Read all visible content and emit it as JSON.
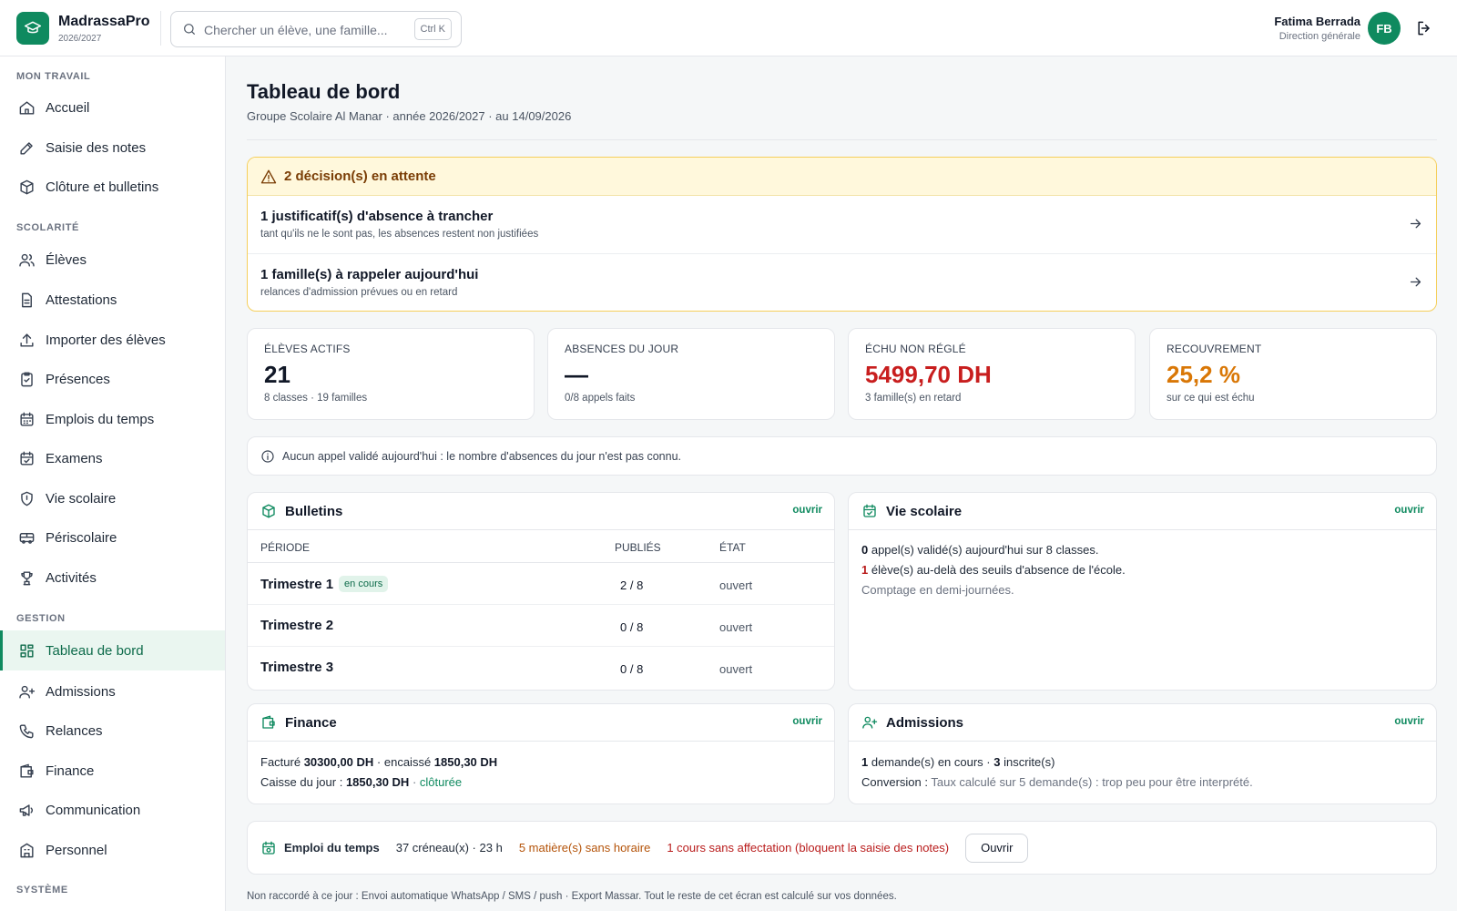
{
  "brand": {
    "name": "MadrassaPro",
    "year": "2026/2027"
  },
  "search": {
    "placeholder": "Chercher un élève, une famille...",
    "shortcut": "Ctrl K"
  },
  "user": {
    "name": "Fatima Berrada",
    "role": "Direction générale",
    "initials": "FB"
  },
  "sidebar": {
    "sections": [
      {
        "label": "MON TRAVAIL",
        "items": [
          {
            "label": "Accueil",
            "icon": "home-icon"
          },
          {
            "label": "Saisie des notes",
            "icon": "pencil-icon"
          },
          {
            "label": "Clôture et bulletins",
            "icon": "package-icon"
          }
        ]
      },
      {
        "label": "SCOLARITÉ",
        "items": [
          {
            "label": "Élèves",
            "icon": "users-icon"
          },
          {
            "label": "Attestations",
            "icon": "document-icon"
          },
          {
            "label": "Importer des élèves",
            "icon": "upload-icon"
          },
          {
            "label": "Présences",
            "icon": "clipboard-check-icon"
          },
          {
            "label": "Emplois du temps",
            "icon": "calendar-icon"
          },
          {
            "label": "Examens",
            "icon": "calendar-check-icon"
          },
          {
            "label": "Vie scolaire",
            "icon": "shield-icon"
          },
          {
            "label": "Périscolaire",
            "icon": "bus-icon"
          },
          {
            "label": "Activités",
            "icon": "trophy-icon"
          }
        ]
      },
      {
        "label": "GESTION",
        "items": [
          {
            "label": "Tableau de bord",
            "icon": "dashboard-icon",
            "active": true
          },
          {
            "label": "Admissions",
            "icon": "user-plus-icon"
          },
          {
            "label": "Relances",
            "icon": "phone-icon"
          },
          {
            "label": "Finance",
            "icon": "wallet-icon"
          },
          {
            "label": "Communication",
            "icon": "megaphone-icon"
          },
          {
            "label": "Personnel",
            "icon": "building-icon"
          }
        ]
      },
      {
        "label": "SYSTÈME",
        "items": []
      }
    ]
  },
  "page": {
    "title": "Tableau de bord",
    "subtitle": "Groupe Scolaire Al Manar · année 2026/2027 · au 14/09/2026"
  },
  "alert": {
    "title": "2 décision(s) en attente",
    "items": [
      {
        "title": "1 justificatif(s) d'absence à trancher",
        "sub": "tant qu'ils ne le sont pas, les absences restent non justifiées"
      },
      {
        "title": "1 famille(s) à rappeler aujourd'hui",
        "sub": "relances d'admission prévues ou en retard"
      }
    ]
  },
  "kpis": [
    {
      "label": "ÉLÈVES ACTIFS",
      "value": "21",
      "sub": "8 classes · 19 familles",
      "color": "#111827"
    },
    {
      "label": "ABSENCES DU JOUR",
      "value": "—",
      "sub": "0/8 appels faits",
      "color": "#111827"
    },
    {
      "label": "ÉCHU NON RÉGLÉ",
      "value": "5499,70 DH",
      "sub": "3 famille(s) en retard",
      "color": "#c81e1e"
    },
    {
      "label": "RECOUVREMENT",
      "value": "25,2 %",
      "sub": "sur ce qui est échu",
      "color": "#d97706"
    }
  ],
  "info": "Aucun appel validé aujourd'hui : le nombre d'absences du jour n'est pas connu.",
  "bulletins": {
    "title": "Bulletins",
    "open": "ouvrir",
    "columns": [
      "PÉRIODE",
      "PUBLIÉS",
      "ÉTAT"
    ],
    "rows": [
      {
        "period": "Trimestre 1",
        "badge": "en cours",
        "published": "2 / 8",
        "state": "ouvert"
      },
      {
        "period": "Trimestre 2",
        "badge": "",
        "published": "0 / 8",
        "state": "ouvert"
      },
      {
        "period": "Trimestre 3",
        "badge": "",
        "published": "0 / 8",
        "state": "ouvert"
      }
    ]
  },
  "vie_scolaire": {
    "title": "Vie scolaire",
    "open": "ouvrir",
    "line1_num": "0",
    "line1_text": " appel(s) validé(s) aujourd'hui sur 8 classes.",
    "line2_num": "1",
    "line2_text": " élève(s) au-delà des seuils d'absence de l'école.",
    "line3": "Comptage en demi-journées."
  },
  "finance": {
    "title": "Finance",
    "open": "ouvrir",
    "billed_label": "Facturé ",
    "billed": "30300,00 DH",
    "collected_label": " · encaissé ",
    "collected": "1850,30 DH",
    "cash_label": "Caisse du jour : ",
    "cash": "1850,30 DH",
    "cash_sep": " · ",
    "cash_status": "clôturée"
  },
  "admissions": {
    "title": "Admissions",
    "open": "ouvrir",
    "requests": "1",
    "requests_label": " demande(s) en cours · ",
    "registered": "3",
    "registered_label": " inscrite(s)",
    "conversion_label": "Conversion : ",
    "conversion_text": "Taux calculé sur 5 demande(s) : trop peu pour être interprété."
  },
  "timetable": {
    "title": "Emploi du temps",
    "slots": "37 créneau(x) · 23 h",
    "no_schedule": "5 matière(s) sans horaire",
    "unassigned": "1 cours sans affectation (bloquent la saisie des notes)",
    "button": "Ouvrir"
  },
  "footnote": "Non raccordé à ce jour : Envoi automatique WhatsApp / SMS / push · Export Massar. Tout le reste de cet écran est calculé sur vos données."
}
